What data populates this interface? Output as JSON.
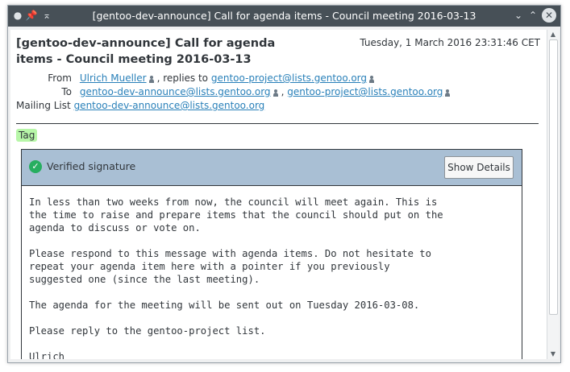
{
  "window": {
    "title": "[gentoo-dev-announce] Call for agenda items - Council meeting 2016-03-13"
  },
  "message": {
    "subject": "[gentoo-dev-announce] Call for agenda items - Council meeting 2016-03-13",
    "subject_line1": "[gentoo-dev-announce] Call for agenda",
    "subject_line2": "items - Council meeting 2016-03-13",
    "date": "Tuesday, 1 March 2016 23:31:46 CET",
    "from_label": "From",
    "from": "Ulrich Mueller",
    "replies_to_label": ", replies to",
    "replies_to": "gentoo-project@lists.gentoo.org",
    "to_label": "To",
    "to": [
      "gentoo-dev-announce@lists.gentoo.org",
      "gentoo-project@lists.gentoo.org"
    ],
    "to_sep": ",",
    "mailing_list_label": "Mailing List",
    "mailing_list": "gentoo-dev-announce@lists.gentoo.org",
    "tag": "Tag"
  },
  "signature": {
    "status": "Verified signature",
    "details_button": "Show Details"
  },
  "body": {
    "p1": "In less than two weeks from now, the council will meet again. This is\nthe time to raise and prepare items that the council should put on the\nagenda to discuss or vote on.",
    "p2": "Please respond to this message with agenda items. Do not hesitate to\nrepeat your agenda item here with a pointer if you previously\nsuggested one (since the last meeting).",
    "p3": "The agenda for the meeting will be sent out on Tuesday 2016-03-08.",
    "p4": "Please reply to the gentoo-project list.",
    "p5": "Ulrich"
  },
  "colors": {
    "titlebar": "#475057",
    "link": "#2980b9",
    "tag_bg": "#b7f6a8",
    "signature_bar": "#a9bfd4",
    "verified": "#27ae60"
  }
}
